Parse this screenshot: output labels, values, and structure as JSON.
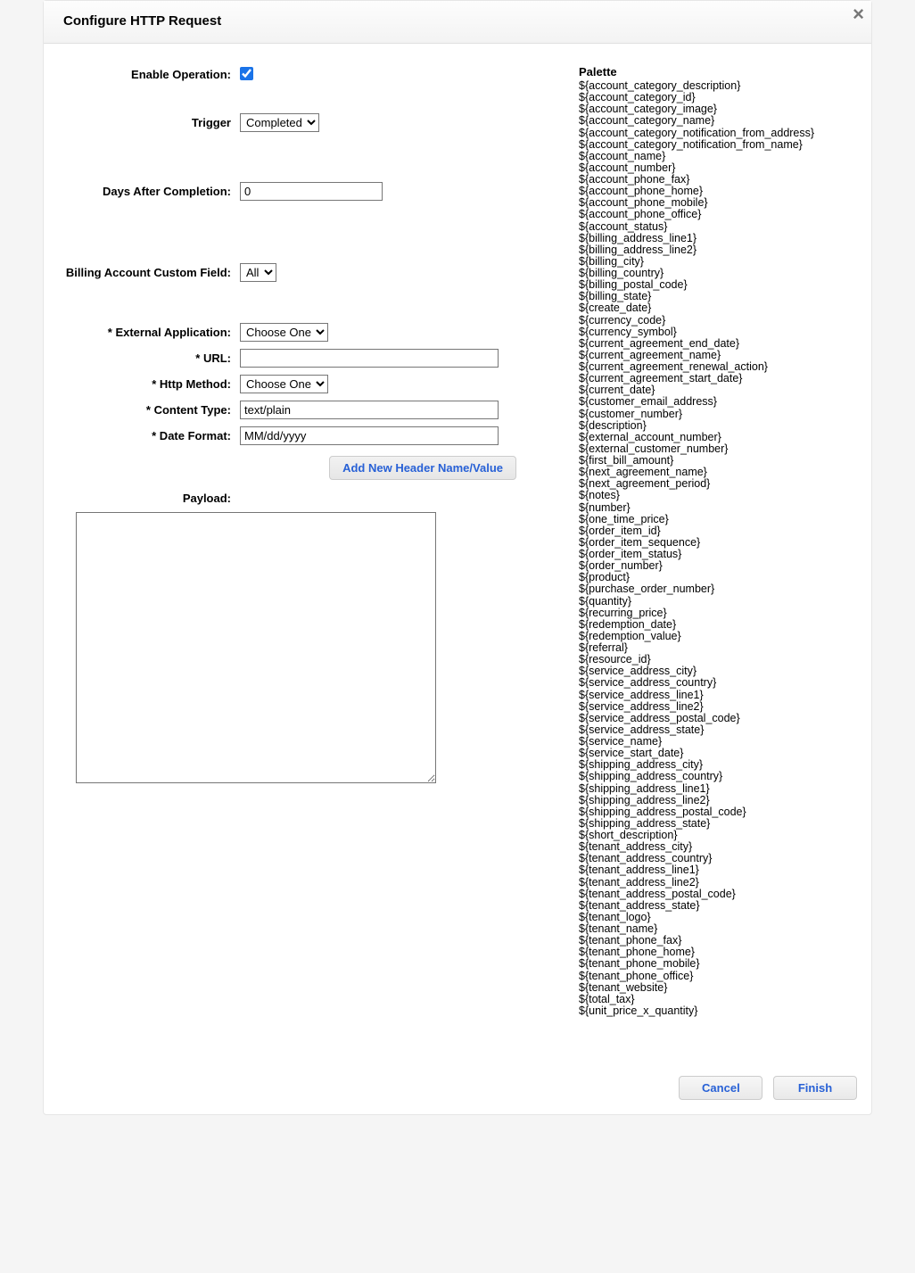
{
  "dialog": {
    "title": "Configure HTTP Request"
  },
  "form": {
    "enable_operation": {
      "label": "Enable Operation:",
      "checked": true
    },
    "trigger": {
      "label": "Trigger",
      "selected": "Completed",
      "options": [
        "Completed"
      ]
    },
    "days_after_completion": {
      "label": "Days After Completion:",
      "value": "0"
    },
    "billing_account_custom_field": {
      "label": "Billing Account Custom Field:",
      "selected": "All",
      "options": [
        "All"
      ]
    },
    "external_application": {
      "label": "* External Application:",
      "selected": "Choose One",
      "options": [
        "Choose One"
      ]
    },
    "url": {
      "label": "* URL:",
      "value": ""
    },
    "http_method": {
      "label": "* Http Method:",
      "selected": "Choose One",
      "options": [
        "Choose One"
      ]
    },
    "content_type": {
      "label": "* Content Type:",
      "value": "text/plain"
    },
    "date_format": {
      "label": "* Date Format:",
      "value": "MM/dd/yyyy"
    },
    "add_header_button": "Add New Header Name/Value",
    "payload": {
      "label": "Payload:",
      "value": ""
    }
  },
  "palette": {
    "title": "Palette",
    "items": [
      "${account_category_description}",
      "${account_category_id}",
      "${account_category_image}",
      "${account_category_name}",
      "${account_category_notification_from_address}",
      "${account_category_notification_from_name}",
      "${account_name}",
      "${account_number}",
      "${account_phone_fax}",
      "${account_phone_home}",
      "${account_phone_mobile}",
      "${account_phone_office}",
      "${account_status}",
      "${billing_address_line1}",
      "${billing_address_line2}",
      "${billing_city}",
      "${billing_country}",
      "${billing_postal_code}",
      "${billing_state}",
      "${create_date}",
      "${currency_code}",
      "${currency_symbol}",
      "${current_agreement_end_date}",
      "${current_agreement_name}",
      "${current_agreement_renewal_action}",
      "${current_agreement_start_date}",
      "${current_date}",
      "${customer_email_address}",
      "${customer_number}",
      "${description}",
      "${external_account_number}",
      "${external_customer_number}",
      "${first_bill_amount}",
      "${next_agreement_name}",
      "${next_agreement_period}",
      "${notes}",
      "${number}",
      "${one_time_price}",
      "${order_item_id}",
      "${order_item_sequence}",
      "${order_item_status}",
      "${order_number}",
      "${product}",
      "${purchase_order_number}",
      "${quantity}",
      "${recurring_price}",
      "${redemption_date}",
      "${redemption_value}",
      "${referral}",
      "${resource_id}",
      "${service_address_city}",
      "${service_address_country}",
      "${service_address_line1}",
      "${service_address_line2}",
      "${service_address_postal_code}",
      "${service_address_state}",
      "${service_name}",
      "${service_start_date}",
      "${shipping_address_city}",
      "${shipping_address_country}",
      "${shipping_address_line1}",
      "${shipping_address_line2}",
      "${shipping_address_postal_code}",
      "${shipping_address_state}",
      "${short_description}",
      "${tenant_address_city}",
      "${tenant_address_country}",
      "${tenant_address_line1}",
      "${tenant_address_line2}",
      "${tenant_address_postal_code}",
      "${tenant_address_state}",
      "${tenant_logo}",
      "${tenant_name}",
      "${tenant_phone_fax}",
      "${tenant_phone_home}",
      "${tenant_phone_mobile}",
      "${tenant_phone_office}",
      "${tenant_website}",
      "${total_tax}",
      "${unit_price_x_quantity}"
    ]
  },
  "footer": {
    "cancel": "Cancel",
    "finish": "Finish"
  }
}
